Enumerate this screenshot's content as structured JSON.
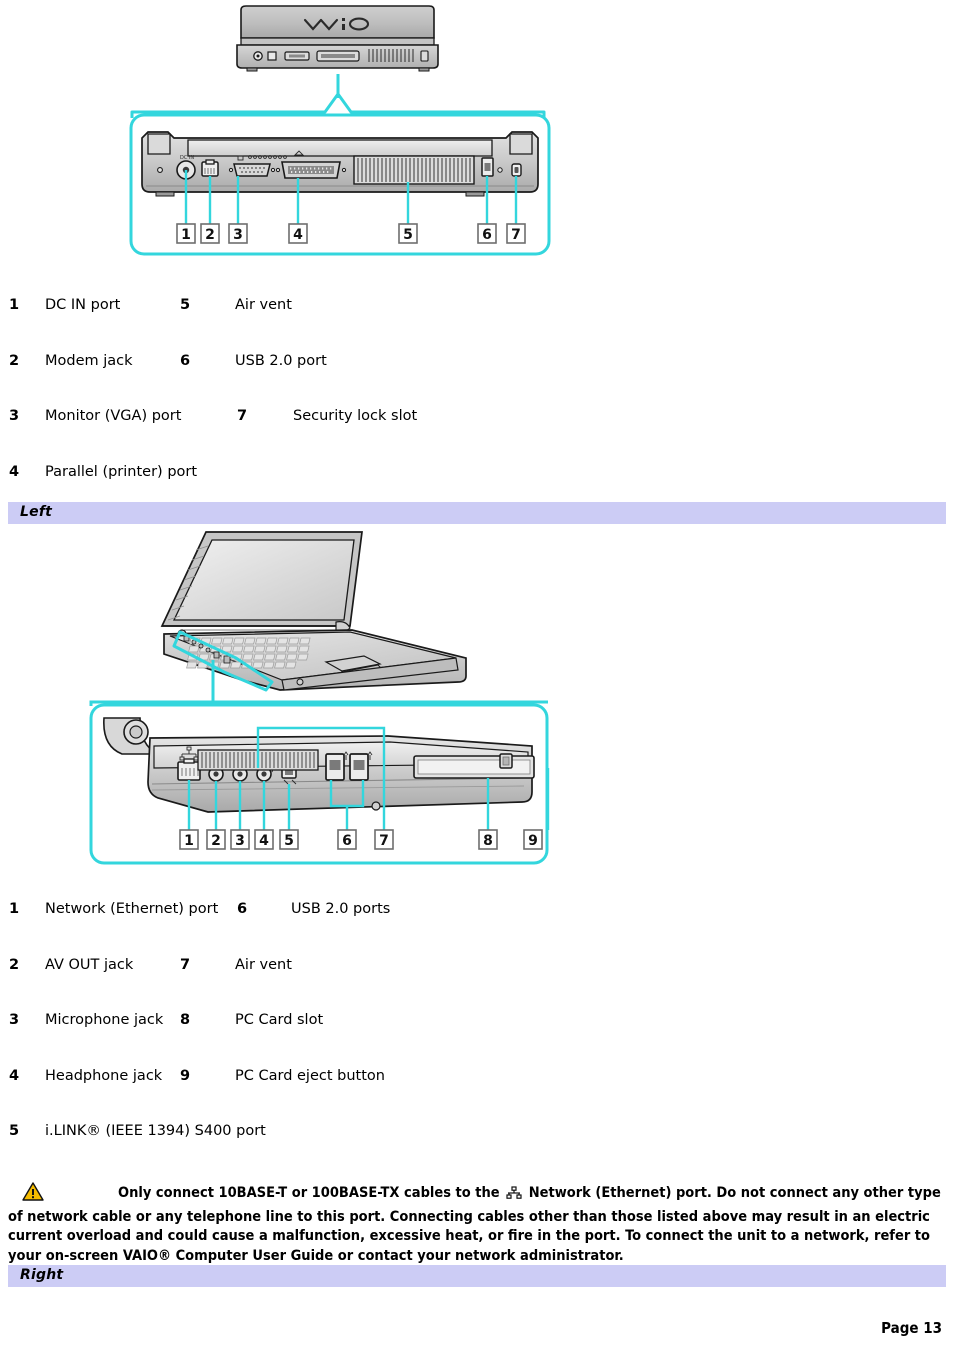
{
  "document": {
    "page_label": "Page 13"
  },
  "rear_figure": {
    "name": "rear-panel-illustration",
    "callout_numbers": [
      "1",
      "2",
      "3",
      "4",
      "5",
      "6",
      "7"
    ],
    "outline_color": "#33d6dd"
  },
  "rear_ports": {
    "rows": [
      {
        "left_num": "1",
        "left_label": "DC IN port",
        "right_num": "5",
        "right_label": "Air vent"
      },
      {
        "left_num": "2",
        "left_label": "Modem jack",
        "right_num": "6",
        "right_label": "USB 2.0 port"
      },
      {
        "left_num": "3",
        "left_label": "Monitor (VGA) port",
        "right_num": "7",
        "right_label": "Security lock slot"
      },
      {
        "left_num": "4",
        "left_label": "Parallel (printer) port",
        "right_num": "",
        "right_label": ""
      }
    ]
  },
  "left_section": {
    "heading": "Left",
    "band_color": "#ccccf5"
  },
  "left_figure": {
    "name": "left-side-illustration",
    "callout_numbers": [
      "1",
      "2",
      "3",
      "4",
      "5",
      "6",
      "7",
      "8",
      "9"
    ],
    "outline_color": "#33d6dd"
  },
  "left_ports": {
    "rows": [
      {
        "left_num": "1",
        "left_label": "Network (Ethernet) port",
        "right_num": "6",
        "right_label": "USB 2.0 ports"
      },
      {
        "left_num": "2",
        "left_label": "AV OUT jack",
        "right_num": "7",
        "right_label": "Air vent"
      },
      {
        "left_num": "3",
        "left_label": "Microphone jack",
        "right_num": "8",
        "right_label": "PC Card slot"
      },
      {
        "left_num": "4",
        "left_label": "Headphone jack",
        "right_num": "9",
        "right_label": "PC Card eject button"
      },
      {
        "left_num": "5",
        "left_label": "i.LINK® (IEEE 1394) S400 port",
        "right_num": "",
        "right_label": ""
      }
    ]
  },
  "warning": {
    "icon": "warning-triangle-icon",
    "icon_color": "#f5bc00",
    "inline_icon": "network-lan-icon",
    "text_part1": "Only connect 10BASE-T or 100BASE-TX cables to the ",
    "text_part2": " Network (Ethernet) port. Do not connect any other type of network cable or any telephone line to this port. Connecting cables other than those listed above may result in an electric current overload and could cause a malfunction, excessive heat, or fire in the port. To connect the unit to a network, refer to your on-screen VAIO® Computer User Guide or contact your network administrator."
  },
  "right_section": {
    "heading": "Right",
    "band_color": "#ccccf5"
  }
}
